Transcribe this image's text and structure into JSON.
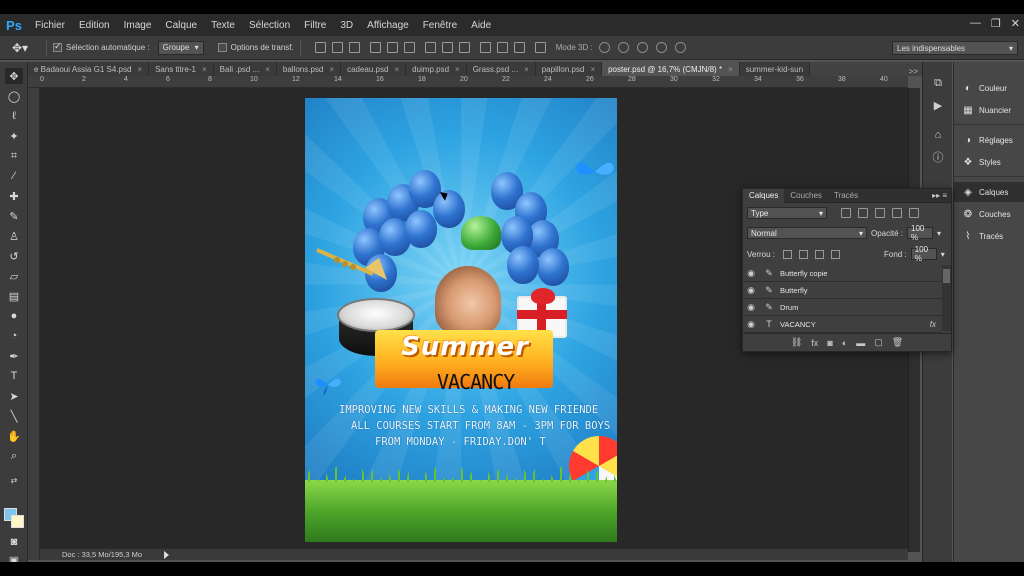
{
  "app": {
    "logo": "Ps"
  },
  "menu": [
    "Fichier",
    "Edition",
    "Image",
    "Calque",
    "Texte",
    "Sélection",
    "Filtre",
    "3D",
    "Affichage",
    "Fenêtre",
    "Aide"
  ],
  "window_controls": {
    "minimize": "—",
    "restore": "❐",
    "close": "✕"
  },
  "options": {
    "auto_select_label": "Sélection automatique :",
    "auto_select_value": "Groupe",
    "transform_label": "Options de transf.",
    "mode3d_label": "Mode 3D :",
    "workspace": "Les indispensables"
  },
  "tabs": [
    {
      "label": "e Badaoui Assia G1 S4.psd",
      "active": false
    },
    {
      "label": "Sans titre-1",
      "active": false
    },
    {
      "label": "Bali .psd ...",
      "active": false
    },
    {
      "label": "ballons.psd",
      "active": false
    },
    {
      "label": "cadeau.psd",
      "active": false
    },
    {
      "label": "duimp.psd",
      "active": false
    },
    {
      "label": "Grass.psd ...",
      "active": false
    },
    {
      "label": "papillon.psd",
      "active": false
    },
    {
      "label": "poster.psd @ 16,7% (CMJN/8) *",
      "active": true
    },
    {
      "label": "summer-kid-sun",
      "active": false
    }
  ],
  "tabs_more": ">>",
  "ruler_ticks": [
    "0",
    "2",
    "4",
    "6",
    "8",
    "10",
    "12",
    "14",
    "16",
    "18",
    "20",
    "22",
    "24",
    "26",
    "28",
    "30",
    "32",
    "34",
    "36",
    "38",
    "40"
  ],
  "poster": {
    "title": "Summer",
    "subtitle": "VACANCY",
    "line1": "IMPROVING NEW SKILLS & MAKING NEW FRIENDE",
    "line2": "ALL COURSES START FROM 8AM - 3PM FOR BOYS",
    "line3": "FROM MONDAY - FRIDAY.DON' T"
  },
  "status": {
    "doc": "Doc : 33,5 Mo/195,3 Mo"
  },
  "dock": [
    {
      "label": "Couleur",
      "icon": "palette-icon",
      "glyph": "◐"
    },
    {
      "label": "Nuancier",
      "icon": "swatches-icon",
      "glyph": "▦"
    },
    {
      "label": "Réglages",
      "icon": "adjustments-icon",
      "glyph": "◑"
    },
    {
      "label": "Styles",
      "icon": "styles-icon",
      "glyph": "❖"
    },
    {
      "label": "Calques",
      "icon": "layers-icon",
      "glyph": "◈"
    },
    {
      "label": "Couches",
      "icon": "channels-icon",
      "glyph": "❂"
    },
    {
      "label": "Tracés",
      "icon": "paths-icon",
      "glyph": "⌇"
    }
  ],
  "layers_panel": {
    "tabs": [
      "Calques",
      "Couches",
      "Tracés"
    ],
    "menu_glyph": "▸▸ ≡",
    "filter": "Type",
    "blend_mode": "Normal",
    "opacity_label": "Opacité :",
    "opacity": "100 %",
    "lock_label": "Verrou :",
    "fill_label": "Fond :",
    "fill": "100 %",
    "layers": [
      {
        "name": "Butterfly copie",
        "type": "brush",
        "glyph": "✎",
        "fx": ""
      },
      {
        "name": "Butterfly",
        "type": "brush",
        "glyph": "✎",
        "fx": ""
      },
      {
        "name": "Drum",
        "type": "brush",
        "glyph": "✎",
        "fx": ""
      },
      {
        "name": "VACANCY",
        "type": "text",
        "glyph": "T",
        "fx": "fx"
      }
    ],
    "footer_glyphs": [
      "⛓",
      "fx",
      "◙",
      "◐",
      "▬",
      "▢",
      "🗑"
    ]
  },
  "colors": {
    "foreground": "#7fc6ef",
    "background": "#fff6c8",
    "accent": "#31a8ff"
  }
}
